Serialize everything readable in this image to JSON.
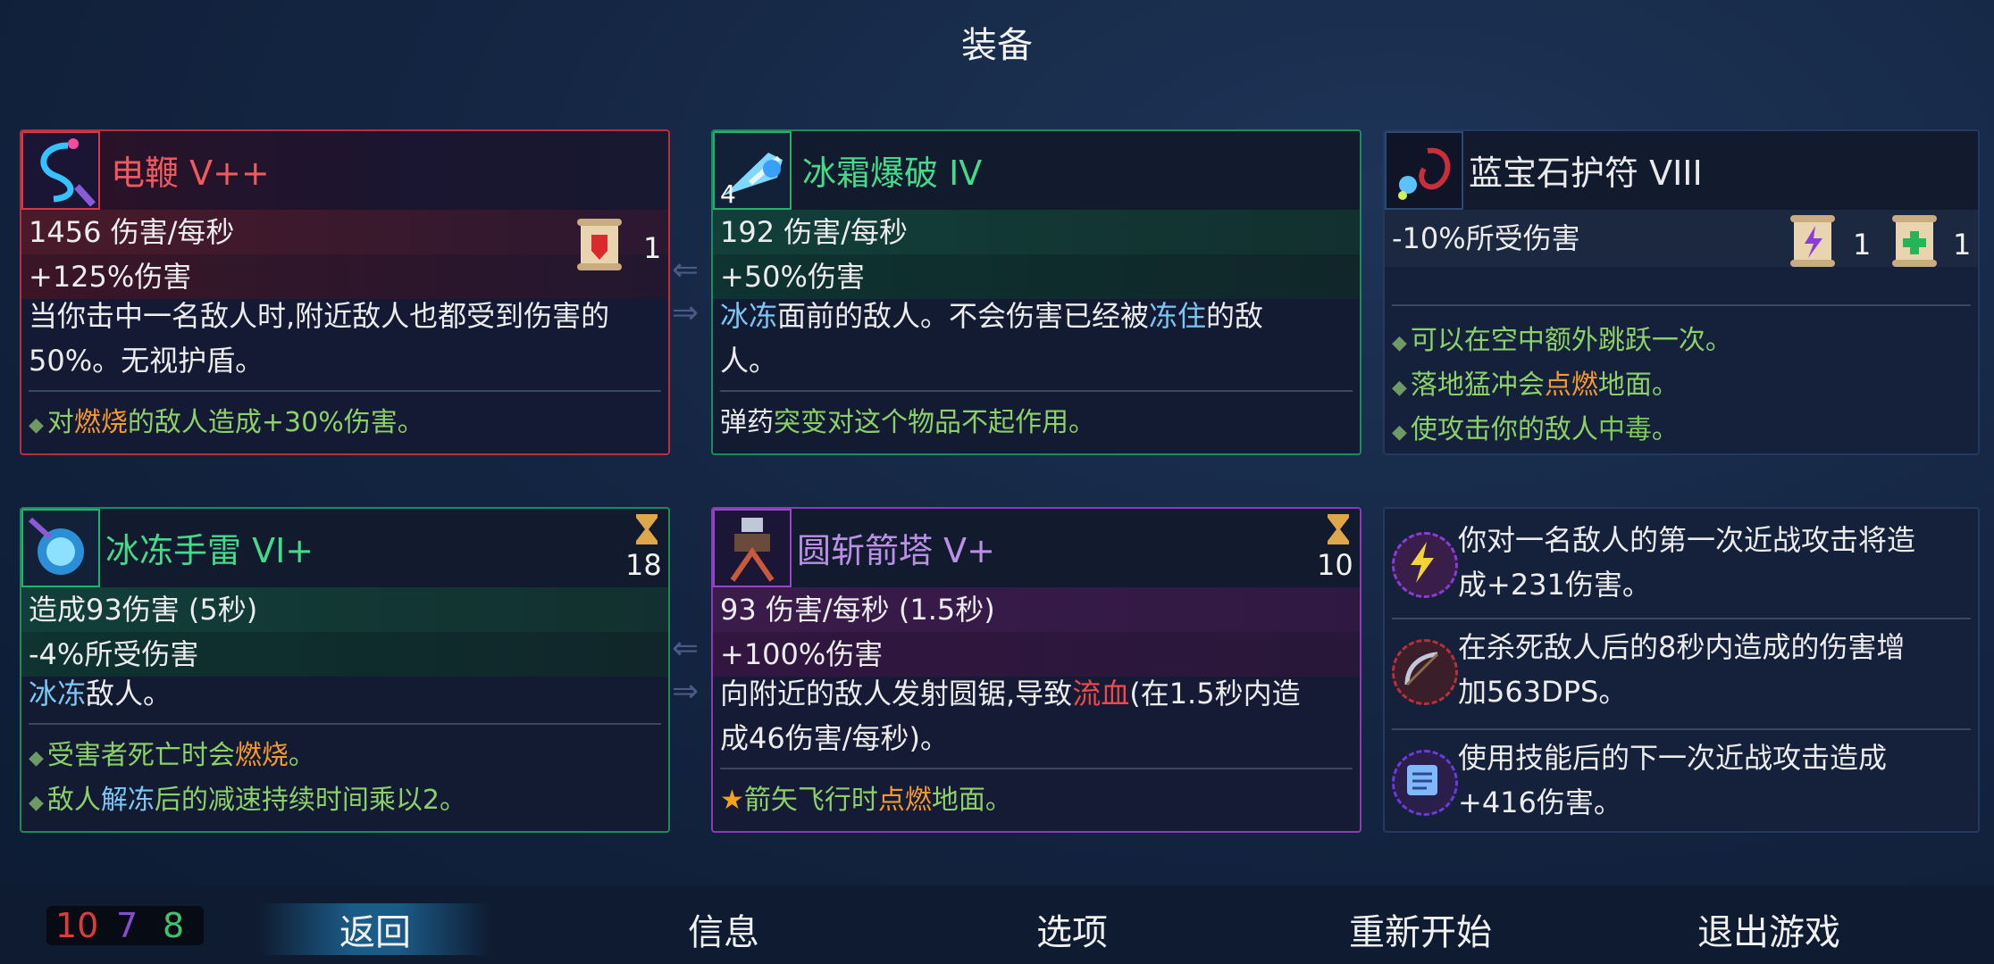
{
  "screen_title": "装备",
  "cards": {
    "whip": {
      "name": "电鞭 V++",
      "stat1": "1456 伤害/每秒",
      "stat2": "+125%伤害",
      "desc_line1": "当你击中一名敌人时,附近敌人也都受到伤害的",
      "desc_line2": "50%。无视护盾。",
      "mod_pre": "对",
      "mod_key": "燃烧",
      "mod_post": "的敌人造成+30%伤害。",
      "scroll_count": "1"
    },
    "frost_blast": {
      "name": "冰霜爆破 IV",
      "badge": "4",
      "stat1": "192 伤害/每秒",
      "stat2": "+50%伤害",
      "desc_key1": "冰冻",
      "desc_mid": "面前的敌人。不会伤害已经被",
      "desc_key2": "冻住",
      "desc_post": "的敌",
      "desc_line2": "人。",
      "note_pre": "弹药",
      "note_key": "突变对这个物品不起作用。"
    },
    "amulet": {
      "name": "蓝宝石护符 VIII",
      "stat1": "-10%所受伤害",
      "scroll1_count": "1",
      "scroll2_count": "1",
      "mod1": "可以在空中额外跳跃一次。",
      "mod2_pre": "落地猛冲会",
      "mod2_key": "点燃",
      "mod2_post": "地面。",
      "mod3_pre": "使攻击你的敌人",
      "mod3_key": "中毒",
      "mod3_post": "。"
    },
    "ice_grenade": {
      "name": "冰冻手雷 VI+",
      "cooldown": "18",
      "stat1": "造成93伤害 (5秒)",
      "stat2": "-4%所受伤害",
      "desc_key": "冰冻",
      "desc_post": "敌人。",
      "mod1_pre": "受害者死亡时会",
      "mod1_key": "燃烧",
      "mod1_post": "。",
      "mod2_pre": "敌人",
      "mod2_key": "解冻",
      "mod2_post": "后的减速持续时间乘以2。"
    },
    "turret": {
      "name": "圆斩箭塔 V+",
      "cooldown": "10",
      "stat1": "93 伤害/每秒 (1.5秒)",
      "stat2": "+100%伤害",
      "desc_pre": "向附近的敌人发射圆锯,导致",
      "desc_key": "流血",
      "desc_post": "(在1.5秒内造",
      "desc_line2": "成46伤害/每秒)。",
      "mod_pre": "箭矢飞行时",
      "mod_key": "点燃",
      "mod_post": "地面。"
    }
  },
  "mutations": [
    {
      "icon": "lightning-mutation-icon",
      "line1": "你对一名敌人的第一次近战攻击将造",
      "line2": "成+231伤害。"
    },
    {
      "icon": "bow-mutation-icon",
      "line1": "在杀死敌人后的8秒内造成的伤害增",
      "line2": "加563DPS。"
    },
    {
      "icon": "scroll-mutation-icon",
      "line1": "使用技能后的下一次近战攻击造成",
      "line2": "+416伤害。"
    }
  ],
  "stats": {
    "brutality": "10",
    "tactics": "7",
    "survival": "8"
  },
  "menu": [
    "返回",
    "信息",
    "选项",
    "重新开始",
    "退出游戏"
  ],
  "colors": {
    "brutality": "#e23a3a",
    "tactics": "#8a4ad8",
    "survival": "#3ec46a"
  }
}
